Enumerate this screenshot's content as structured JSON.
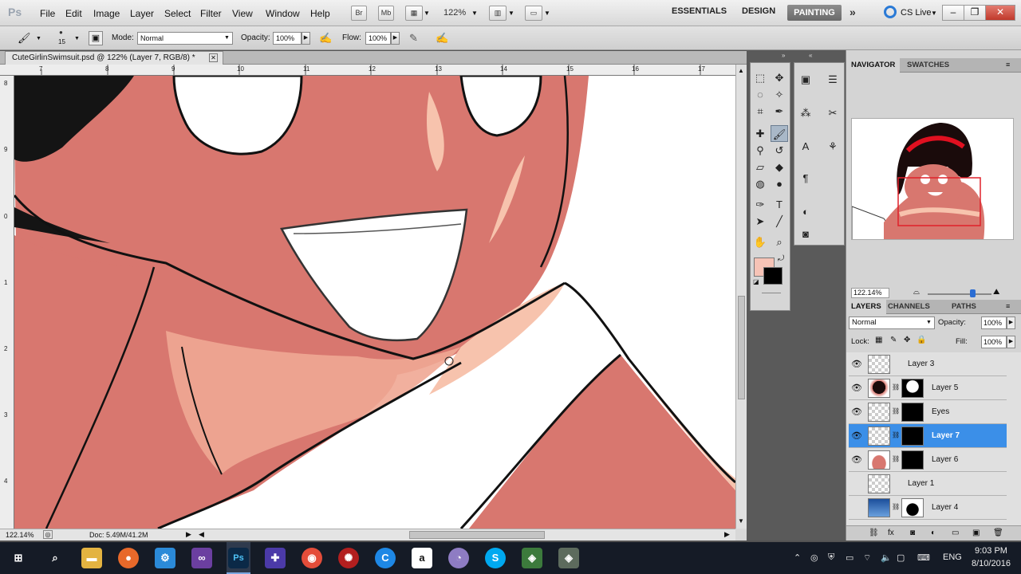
{
  "app": {
    "logo": "Ps",
    "menu": [
      "File",
      "Edit",
      "Image",
      "Layer",
      "Select",
      "Filter",
      "View",
      "Window",
      "Help"
    ],
    "bridge_btn": "Br",
    "minibridge_btn": "Mb",
    "zoom_menu": "122%",
    "workspaces": [
      "ESSENTIALS",
      "DESIGN",
      "PAINTING"
    ],
    "active_workspace": "PAINTING",
    "more_icon": "double-chevron-icon",
    "cs_live": "CS Live",
    "window_controls": [
      "minimize",
      "restore",
      "close"
    ]
  },
  "options": {
    "brush_size": "15",
    "mode_label": "Mode:",
    "mode_value": "Normal",
    "opacity_label": "Opacity:",
    "opacity_value": "100%",
    "flow_label": "Flow:",
    "flow_value": "100%"
  },
  "document": {
    "tab_title": "CuteGirlinSwimsuit.psd @ 122% (Layer 7, RGB/8) *",
    "ruler_h": [
      "7",
      "8",
      "9",
      "10",
      "11",
      "12",
      "13",
      "14",
      "15",
      "16",
      "17"
    ],
    "ruler_v": [
      "8",
      "9",
      "0",
      "1",
      "2",
      "3",
      "4"
    ],
    "status_zoom": "122.14%",
    "status_doc": "Doc: 5.49M/41.2M"
  },
  "colors": {
    "skin": "#d8766f",
    "highlight": "#f7c3ad",
    "foreground": "#f6c3b6",
    "background": "#000000",
    "selected_layer": "#3b8fe8"
  },
  "navigator": {
    "tabs": [
      "NAVIGATOR",
      "SWATCHES"
    ],
    "zoom_value": "122.14%",
    "zoom_slider": 0.7
  },
  "layers": {
    "tabs": [
      "LAYERS",
      "CHANNELS",
      "PATHS"
    ],
    "blend_mode": "Normal",
    "opacity_label": "Opacity:",
    "opacity_value": "100%",
    "lock_label": "Lock:",
    "fill_label": "Fill:",
    "fill_value": "100%",
    "items": [
      {
        "name": "Layer 3",
        "visible": true,
        "has_mask": false,
        "selected": false
      },
      {
        "name": "Layer 5",
        "visible": true,
        "has_mask": true,
        "selected": false
      },
      {
        "name": "Eyes",
        "visible": true,
        "has_mask": true,
        "selected": false
      },
      {
        "name": "Layer 7",
        "visible": true,
        "has_mask": true,
        "selected": true
      },
      {
        "name": "Layer 6",
        "visible": true,
        "has_mask": true,
        "selected": false
      },
      {
        "name": "Layer 1",
        "visible": false,
        "has_mask": false,
        "selected": false
      },
      {
        "name": "Layer 4",
        "visible": false,
        "has_mask": true,
        "selected": false
      }
    ]
  },
  "taskbar": {
    "apps": [
      "windows-start",
      "search",
      "file-explorer",
      "firefox",
      "settings-app",
      "visual-studio",
      "photoshop",
      "app-purple",
      "chrome",
      "app-red",
      "app-blue",
      "amazon",
      "app-swirl",
      "skype",
      "app-green",
      "app-gray"
    ],
    "language": "ENG",
    "time": "9:03 PM",
    "date": "8/10/2016"
  }
}
